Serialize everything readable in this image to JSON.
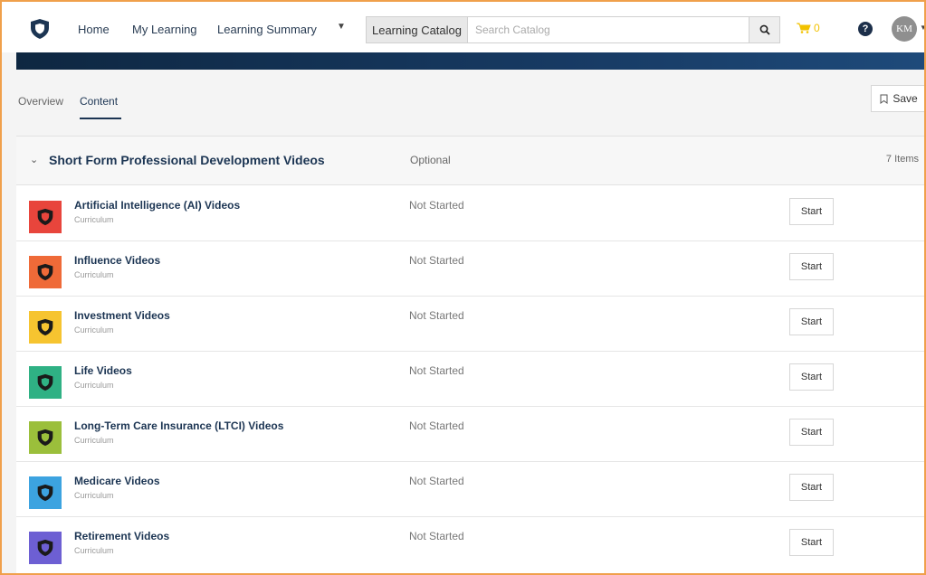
{
  "nav": {
    "home": "Home",
    "my_learning": "My Learning",
    "learning_summary": "Learning Summary",
    "catalog_label": "Learning Catalog",
    "search_placeholder": "Search Catalog",
    "cart_count": "0",
    "help": "?",
    "avatar_initials": "KM"
  },
  "tabs": {
    "overview": "Overview",
    "content": "Content",
    "save": "Save"
  },
  "section": {
    "title": "Short Form Professional Development Videos",
    "requirement": "Optional",
    "count": "7 Items"
  },
  "items": [
    {
      "title": "Artificial Intelligence (AI) Videos",
      "type": "Curriculum",
      "status": "Not Started",
      "action": "Start",
      "color": "#e8453c",
      "icon": "shield-icon"
    },
    {
      "title": "Influence Videos",
      "type": "Curriculum",
      "status": "Not Started",
      "action": "Start",
      "color": "#ef6a38",
      "icon": "shield-icon"
    },
    {
      "title": "Investment Videos",
      "type": "Curriculum",
      "status": "Not Started",
      "action": "Start",
      "color": "#f6c430",
      "icon": "shield-icon"
    },
    {
      "title": "Life Videos",
      "type": "Curriculum",
      "status": "Not Started",
      "action": "Start",
      "color": "#2fb184",
      "icon": "shield-icon"
    },
    {
      "title": "Long-Term Care Insurance (LTCI) Videos",
      "type": "Curriculum",
      "status": "Not Started",
      "action": "Start",
      "color": "#9bbf3b",
      "icon": "shield-icon"
    },
    {
      "title": "Medicare Videos",
      "type": "Curriculum",
      "status": "Not Started",
      "action": "Start",
      "color": "#3ca3e0",
      "icon": "shield-icon"
    },
    {
      "title": "Retirement Videos",
      "type": "Curriculum",
      "status": "Not Started",
      "action": "Start",
      "color": "#6d5fd3",
      "icon": "shield-icon"
    }
  ],
  "colors": {
    "brand_navy": "#1c3553",
    "cart_yellow": "#f2c200",
    "frame_orange": "#f0a04b"
  }
}
